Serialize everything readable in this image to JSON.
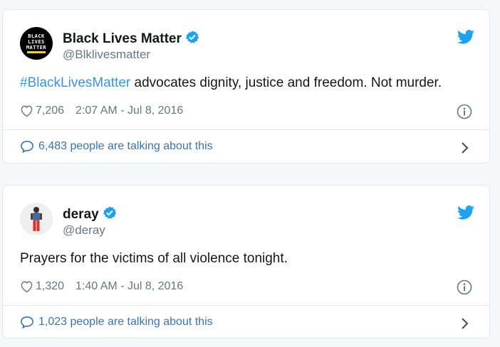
{
  "tweets": [
    {
      "name": "Black Lives Matter",
      "handle": "@Blklivesmatter",
      "avatar_text": [
        "BLACK",
        "LIVES",
        "MATTER"
      ],
      "hashtag": "#BlackLivesMatter",
      "text": " advocates dignity, justice and freedom. Not murder.",
      "likes": "7,206",
      "timestamp": "2:07 AM - Jul 8, 2016",
      "talking": "6,483 people are talking about this"
    },
    {
      "name": "deray",
      "handle": "@deray",
      "text": "Prayers for the victims of all violence tonight.",
      "likes": "1,320",
      "timestamp": "1:40 AM - Jul 8, 2016",
      "talking": "1,023 people are talking about this"
    }
  ],
  "icons": {
    "verified": "verified-badge-icon",
    "brand": "twitter-bird-icon",
    "like": "heart-icon",
    "info": "info-icon",
    "reply": "speech-bubble-icon",
    "chevron": "chevron-right-icon"
  },
  "colors": {
    "twitter_blue": "#1da1f2",
    "link_blue": "#3b73af",
    "hashtag_blue": "#3b94d9",
    "muted_gray": "#657786",
    "background": "#f5f8fa",
    "border": "#e1e8ed"
  }
}
